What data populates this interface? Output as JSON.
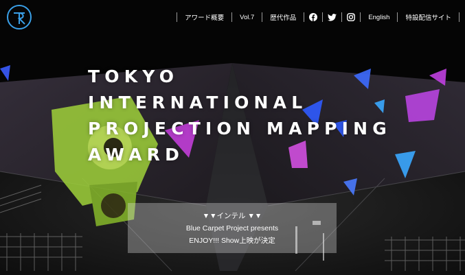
{
  "header": {
    "logo_icon": "tpam-logo-icon",
    "nav": [
      {
        "label": "アワード概要"
      },
      {
        "label": "Vol.7"
      },
      {
        "label": "歴代作品"
      },
      {
        "icon": "facebook-icon"
      },
      {
        "icon": "twitter-icon"
      },
      {
        "icon": "instagram-icon"
      },
      {
        "label": "English"
      },
      {
        "label": "特設配信サイト"
      }
    ]
  },
  "hero": {
    "title_lines": [
      "TOKYO",
      "INTERNATIONAL",
      "PROJECTION MAPPING",
      "AWARD"
    ]
  },
  "news": {
    "line1": "▼▼インテル ▼▼",
    "line2": "Blue Carpet Project presents",
    "line3": "ENJOY!!! Show上映が決定"
  },
  "colors": {
    "logo_blue": "#3aa0e8",
    "projection_blue": "#2f5bff",
    "projection_purple": "#c23ed8",
    "projection_lime": "#b9e84a"
  }
}
